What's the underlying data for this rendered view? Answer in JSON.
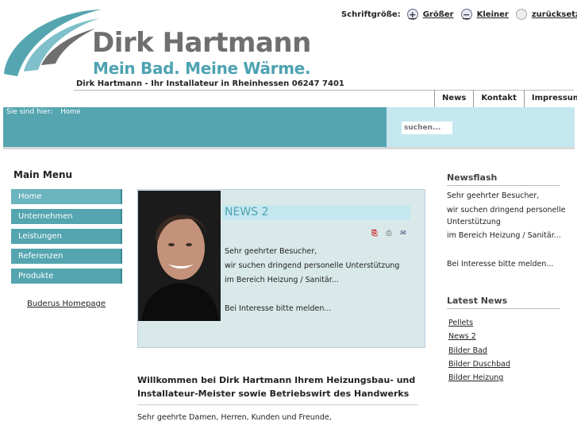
{
  "header": {
    "name": "Dirk Hartmann",
    "slogan": "Mein Bad. Meine Wärme.",
    "tagline": "Dirk Hartmann - Ihr Installateur in Rheinhessen 06247 7401"
  },
  "fontsize": {
    "label": "Schriftgröße:",
    "bigger": "Größer",
    "smaller": "Kleiner",
    "reset": "zurücksetzen"
  },
  "topnav": [
    "News",
    "Kontakt",
    "Impressum"
  ],
  "breadcrumb": {
    "label": "Sie sind hier:",
    "home": "Home"
  },
  "search": {
    "placeholder": "suchen..."
  },
  "main_menu": {
    "title": "Main Menu",
    "items": [
      "Home",
      "Unternehmen",
      "Leistungen",
      "Referenzen",
      "Produkte"
    ],
    "extra_link": "Buderus Homepage"
  },
  "news": {
    "title": "NEWS 2",
    "lines": [
      "Sehr geehrter Besucher,",
      "wir suchen dringend personelle Unterstützung",
      "im Bereich Heizung / Sanitär...",
      "Bei Interesse bitte melden..."
    ]
  },
  "welcome": {
    "heading": "Willkommen bei Dirk Hartmann Ihrem Heizungsbau- und Installateur-Meister sowie Betriebswirt des Handwerks",
    "text": "Sehr geehrte Damen, Herren, Kunden und Freunde,"
  },
  "newsflash": {
    "title": "Newsflash",
    "lines": [
      "Sehr geehrter Besucher,",
      "wir suchen dringend personelle Unterstützung",
      "im Bereich Heizung / Sanitär...",
      "Bei Interesse bitte melden..."
    ]
  },
  "latest_news": {
    "title": "Latest News",
    "items": [
      "Pellets",
      "News 2",
      "Bilder Bad",
      "Bilder Duschbad",
      "Bilder Heizung"
    ]
  },
  "colors": {
    "teal": "#54a5b0",
    "light_blue": "#c5e8f0",
    "logo_grey": "#6f6f6f"
  }
}
